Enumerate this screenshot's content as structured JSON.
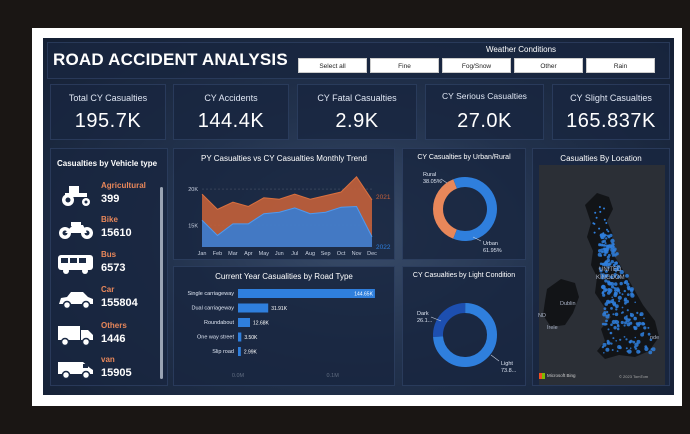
{
  "header": {
    "title": "ROAD ACCIDENT ANALYSIS"
  },
  "weather": {
    "title": "Weather Conditions",
    "options": [
      "Select all",
      "Fine",
      "Fog/Snow",
      "Other",
      "Rain"
    ]
  },
  "kpis": [
    {
      "label": "Total CY Casualties",
      "value": "195.7K"
    },
    {
      "label": "CY Accidents",
      "value": "144.4K"
    },
    {
      "label": "CY Fatal Casualties",
      "value": "2.9K"
    },
    {
      "label": "CY Serious Casualties",
      "value": "27.0K"
    },
    {
      "label": "CY Slight Casualties",
      "value": "165.837K"
    }
  ],
  "vehicles": {
    "title": "Casualties by Vehicle type",
    "items": [
      {
        "name": "Agricultural",
        "value": "399",
        "icon": "tractor-icon"
      },
      {
        "name": "Bike",
        "value": "15610",
        "icon": "motorbike-icon"
      },
      {
        "name": "Bus",
        "value": "6573",
        "icon": "bus-icon"
      },
      {
        "name": "Car",
        "value": "155804",
        "icon": "car-icon"
      },
      {
        "name": "Others",
        "value": "1446",
        "icon": "truck-icon"
      },
      {
        "name": "van",
        "value": "15905",
        "icon": "van-icon"
      }
    ]
  },
  "map": {
    "title": "Casualties By Location",
    "labels": [
      "UNITED",
      "KINGDOM",
      "Dublin",
      "ND",
      "Irele",
      "Microsoft Bing",
      "© 2023 TomTom",
      "nde"
    ]
  },
  "colors": {
    "cy": "#2f7fdd",
    "py": "#c4603a",
    "accent": "#e8875a",
    "donut_orange": "#e8875a",
    "donut_blue": "#2f7fdd"
  },
  "chart_data": [
    {
      "type": "area",
      "title": "PY Casualties vs CY Casualties Monthly Trend",
      "categories": [
        "Jan",
        "Feb",
        "Mar",
        "Apr",
        "May",
        "Jun",
        "Jul",
        "Aug",
        "Sep",
        "Oct",
        "Nov",
        "Dec"
      ],
      "yticks": [
        "20K",
        "15K"
      ],
      "ylim": [
        12000,
        22500
      ],
      "series": [
        {
          "name": "2021",
          "values": [
            19300,
            17200,
            18200,
            17600,
            18800,
            18600,
            19300,
            18600,
            19100,
            19600,
            21700,
            18500
          ]
        },
        {
          "name": "2022",
          "values": [
            15700,
            13600,
            15200,
            15200,
            16600,
            16800,
            17400,
            16600,
            16800,
            17500,
            17600,
            13400
          ]
        }
      ]
    },
    {
      "type": "pie",
      "title": "CY Casualties by Urban/Rural",
      "slices": [
        {
          "name": "Rural",
          "value": 38.05,
          "label": "38.05%"
        },
        {
          "name": "Urban",
          "value": 61.95,
          "label": "61.95%"
        }
      ]
    },
    {
      "type": "bar",
      "title": "Current Year Casualities by Road Type",
      "categories": [
        "Single carriageway",
        "Dual carriageway",
        "Roundabout",
        "One way street",
        "Slip road"
      ],
      "values": [
        144.65,
        31.91,
        12.68,
        3.5,
        2.99
      ],
      "labels": [
        "144.65K",
        "31.91K",
        "12.68K",
        "3.50K",
        "2.99K"
      ],
      "xticks": [
        "0.0M",
        "0.1M"
      ],
      "xlim": [
        0,
        150
      ]
    },
    {
      "type": "pie",
      "title": "CY Casualties by Light Condition",
      "slices": [
        {
          "name": "Dark",
          "value": 26.1,
          "label": "26.1..."
        },
        {
          "name": "Light",
          "value": 73.8,
          "label": "73.8..."
        }
      ]
    }
  ]
}
